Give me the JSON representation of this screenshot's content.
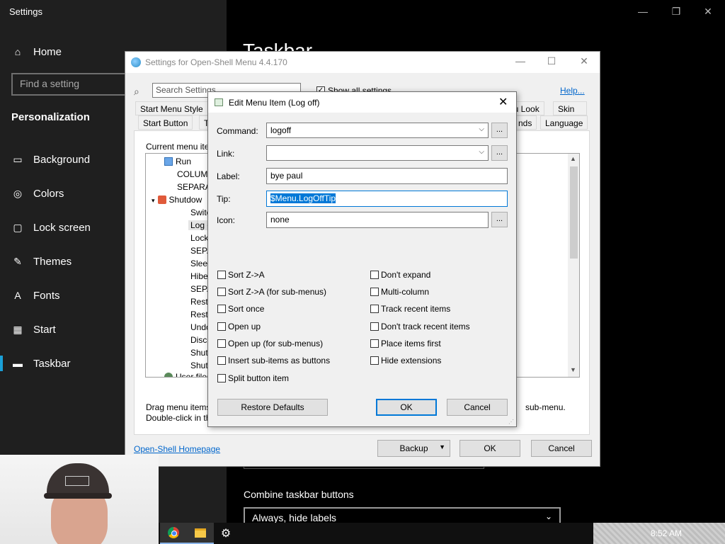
{
  "settings_window": {
    "title": "Settings",
    "home_label": "Home",
    "search_placeholder": "Find a setting",
    "section": "Personalization",
    "nav": [
      {
        "label": "Background",
        "icon": "image-icon"
      },
      {
        "label": "Colors",
        "icon": "palette-icon"
      },
      {
        "label": "Lock screen",
        "icon": "lock-screen-icon"
      },
      {
        "label": "Themes",
        "icon": "themes-icon"
      },
      {
        "label": "Fonts",
        "icon": "fonts-icon"
      },
      {
        "label": "Start",
        "icon": "start-icon"
      },
      {
        "label": "Taskbar",
        "icon": "taskbar-icon"
      }
    ],
    "page_title": "Taskbar",
    "combine_label": "Combine taskbar buttons",
    "combine_value": "Always, hide labels"
  },
  "open_shell": {
    "title": "Settings for Open-Shell Menu 4.4.170",
    "search_placeholder": "Search Settings",
    "show_all_label": "Show all settings",
    "help_label": "Help...",
    "tabs_row1": [
      "Start Menu Style",
      "Ta",
      "nu Look",
      "Skin"
    ],
    "tabs_row2": [
      "Start Button",
      "nds",
      "Language"
    ],
    "current_menu_label": "Current menu ite",
    "tree": [
      {
        "label": "Run",
        "icon": "run-icon"
      },
      {
        "label": "COLUM",
        "icon": ""
      },
      {
        "label": "SEPARAT",
        "icon": ""
      },
      {
        "label": "Shutdow",
        "icon": "power-icon"
      },
      {
        "label": "Switc",
        "icon": ""
      },
      {
        "label": "Log o",
        "icon": ""
      },
      {
        "label": "Lock",
        "icon": ""
      },
      {
        "label": "SEPA",
        "icon": ""
      },
      {
        "label": "Sleep",
        "icon": ""
      },
      {
        "label": "Hibe",
        "icon": ""
      },
      {
        "label": "SEPA",
        "icon": ""
      },
      {
        "label": "Resta",
        "icon": ""
      },
      {
        "label": "Resta",
        "icon": ""
      },
      {
        "label": "Undo",
        "icon": ""
      },
      {
        "label": "Disco",
        "icon": ""
      },
      {
        "label": "Shut",
        "icon": ""
      },
      {
        "label": "Shut",
        "icon": ""
      },
      {
        "label": "User files",
        "icon": "user-icon"
      }
    ],
    "drag_text_1": "Drag menu items",
    "drag_text_2": "Double-click in th",
    "submenu_text": "sub-menu.",
    "homepage_label": "Open-Shell Homepage",
    "backup_label": "Backup",
    "ok_label": "OK",
    "cancel_label": "Cancel"
  },
  "dialog": {
    "title": "Edit Menu Item (Log off)",
    "command_label": "Command:",
    "command_value": "logoff",
    "link_label": "Link:",
    "link_value": "",
    "label_label": "Label:",
    "label_value": "bye paul",
    "tip_label": "Tip:",
    "tip_value": "$Menu.LogOffTip",
    "icon_label": "Icon:",
    "icon_value": "none",
    "dots": "...",
    "checkboxes_left": [
      {
        "label": "Sort Z->A",
        "checked": false
      },
      {
        "label": "Sort Z->A (for sub-menus)",
        "checked": false
      },
      {
        "label": "Sort once",
        "checked": false
      },
      {
        "label": "Open up",
        "checked": false
      },
      {
        "label": "Open up (for sub-menus)",
        "checked": false
      },
      {
        "label": "Insert sub-items as buttons",
        "checked": false
      },
      {
        "label": "Split button item",
        "checked": false
      }
    ],
    "checkboxes_right": [
      {
        "label": "Don't expand",
        "checked": false
      },
      {
        "label": "Multi-column",
        "checked": false
      },
      {
        "label": "Track recent items",
        "checked": false
      },
      {
        "label": "Don't track recent items",
        "checked": false
      },
      {
        "label": "Place items first",
        "checked": false
      },
      {
        "label": "Hide extensions",
        "checked": false
      }
    ],
    "restore_label": "Restore Defaults",
    "ok_label": "OK",
    "cancel_label": "Cancel"
  },
  "taskbar": {
    "clock": "8:52 AM"
  },
  "colors": {
    "accent": "#0078d7",
    "settings_selection": "#1aa0d8"
  }
}
